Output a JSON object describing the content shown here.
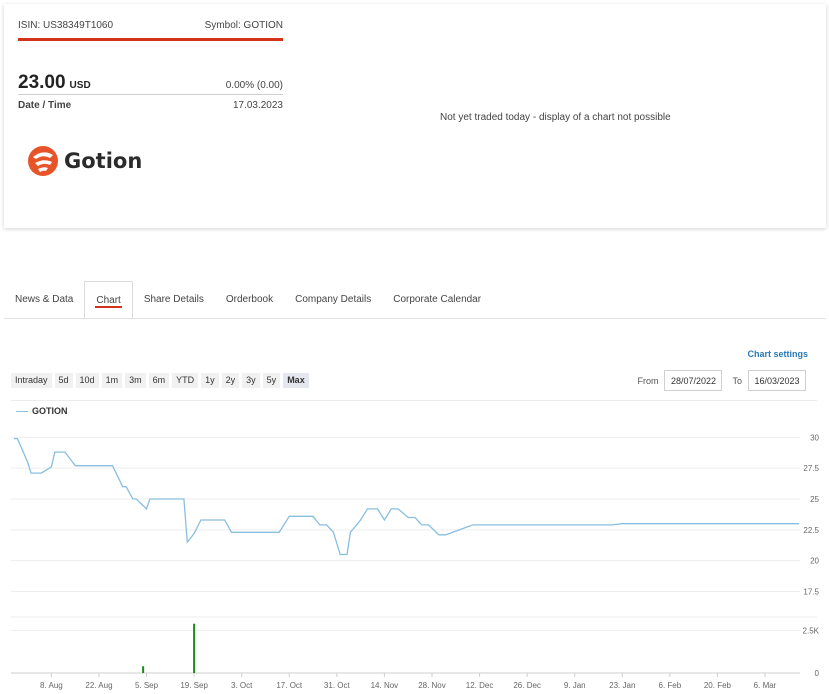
{
  "quote": {
    "isin": "ISIN: US38349T1060",
    "symbol": "Symbol: GOTION",
    "price": "23.00",
    "currency": "USD",
    "change": "0.00% (0.00)",
    "date_label": "Date / Time",
    "date_value": "17.03.2023",
    "company_logo_text": "Gotion",
    "message": "Not yet traded today - display of a chart not possible"
  },
  "tabs": [
    {
      "label": "News & Data",
      "active": false
    },
    {
      "label": "Chart",
      "active": true
    },
    {
      "label": "Share Details",
      "active": false
    },
    {
      "label": "Orderbook",
      "active": false
    },
    {
      "label": "Company Details",
      "active": false
    },
    {
      "label": "Corporate Calendar",
      "active": false
    }
  ],
  "chart_controls": {
    "settings_label": "Chart settings",
    "periods": [
      "Intraday",
      "5d",
      "10d",
      "1m",
      "3m",
      "6m",
      "YTD",
      "1y",
      "2y",
      "3y",
      "5y",
      "Max"
    ],
    "active_period": "Max",
    "from_label": "From",
    "from_value": "28/07/2022",
    "to_label": "To",
    "to_value": "16/03/2023"
  },
  "colors": {
    "accent_red": "#d4321d",
    "line_blue": "#88bfdf",
    "volume_green": "#1a8a1a",
    "link_blue": "#2a7ab5"
  },
  "chart_data": {
    "type": "line",
    "series": [
      {
        "name": "GOTION",
        "x": [
          "2022-07-28",
          "2022-07-29",
          "2022-08-01",
          "2022-08-02",
          "2022-08-03",
          "2022-08-05",
          "2022-08-08",
          "2022-08-09",
          "2022-08-10",
          "2022-08-12",
          "2022-08-15",
          "2022-08-17",
          "2022-08-19",
          "2022-08-22",
          "2022-08-25",
          "2022-08-26",
          "2022-08-29",
          "2022-08-30",
          "2022-09-01",
          "2022-09-02",
          "2022-09-05",
          "2022-09-06",
          "2022-09-07",
          "2022-09-09",
          "2022-09-12",
          "2022-09-14",
          "2022-09-16",
          "2022-09-17",
          "2022-09-19",
          "2022-09-21",
          "2022-09-23",
          "2022-09-26",
          "2022-09-28",
          "2022-09-30",
          "2022-10-03",
          "2022-10-06",
          "2022-10-10",
          "2022-10-12",
          "2022-10-14",
          "2022-10-17",
          "2022-10-19",
          "2022-10-21",
          "2022-10-24",
          "2022-10-26",
          "2022-10-28",
          "2022-10-30",
          "2022-11-01",
          "2022-11-03",
          "2022-11-04",
          "2022-11-07",
          "2022-11-09",
          "2022-11-10",
          "2022-11-12",
          "2022-11-14",
          "2022-11-16",
          "2022-11-18",
          "2022-11-21",
          "2022-11-23",
          "2022-11-25",
          "2022-11-27",
          "2022-11-30",
          "2022-12-02",
          "2022-12-10",
          "2023-01-01",
          "2023-01-20",
          "2023-01-23",
          "2023-02-10",
          "2023-03-16"
        ],
        "y": [
          29.9,
          29.9,
          28.0,
          27.1,
          27.1,
          27.1,
          27.6,
          28.8,
          28.8,
          28.8,
          27.7,
          27.7,
          27.7,
          27.7,
          27.7,
          27.7,
          26.0,
          26.0,
          25.0,
          25.0,
          24.2,
          25.0,
          25.0,
          25.0,
          25.0,
          25.0,
          25.0,
          21.5,
          22.2,
          23.3,
          23.3,
          23.3,
          23.3,
          22.3,
          22.3,
          22.3,
          22.3,
          22.3,
          22.3,
          23.6,
          23.6,
          23.6,
          23.6,
          22.9,
          22.9,
          22.3,
          20.5,
          20.5,
          22.3,
          23.3,
          24.2,
          24.2,
          24.2,
          23.3,
          24.2,
          24.2,
          23.5,
          23.5,
          22.9,
          22.9,
          22.1,
          22.1,
          22.9,
          22.9,
          22.9,
          23.0,
          23.0,
          23.0
        ]
      }
    ],
    "volume": [
      {
        "x": "2022-09-04",
        "v": 400
      },
      {
        "x": "2022-09-19",
        "v": 2900
      }
    ],
    "x_tick_labels": [
      "8. Aug",
      "22. Aug",
      "5. Sep",
      "19. Sep",
      "3. Oct",
      "17. Oct",
      "31. Oct",
      "14. Nov",
      "28. Nov",
      "12. Dec",
      "26. Dec",
      "9. Jan",
      "23. Jan",
      "6. Feb",
      "20. Feb",
      "6. Mar"
    ],
    "x_tick_dates": [
      "2022-08-08",
      "2022-08-22",
      "2022-09-05",
      "2022-09-19",
      "2022-10-03",
      "2022-10-17",
      "2022-10-31",
      "2022-11-14",
      "2022-11-28",
      "2022-12-12",
      "2022-12-26",
      "2023-01-09",
      "2023-01-23",
      "2023-02-06",
      "2023-02-20",
      "2023-03-06"
    ],
    "y_ticks": [
      17.5,
      20,
      22.5,
      25,
      27.5,
      30
    ],
    "y_tick_labels": [
      "17.5",
      "20",
      "22.5",
      "25",
      "27.5",
      "30"
    ],
    "ylim": [
      16,
      31
    ],
    "volume_ticks": [
      0,
      2500
    ],
    "volume_tick_labels": [
      "0",
      "2.5K"
    ],
    "volume_ylim": [
      0,
      3000
    ],
    "xlim": [
      "2022-07-28",
      "2023-03-16"
    ],
    "grid": true,
    "legend": "top-left"
  }
}
